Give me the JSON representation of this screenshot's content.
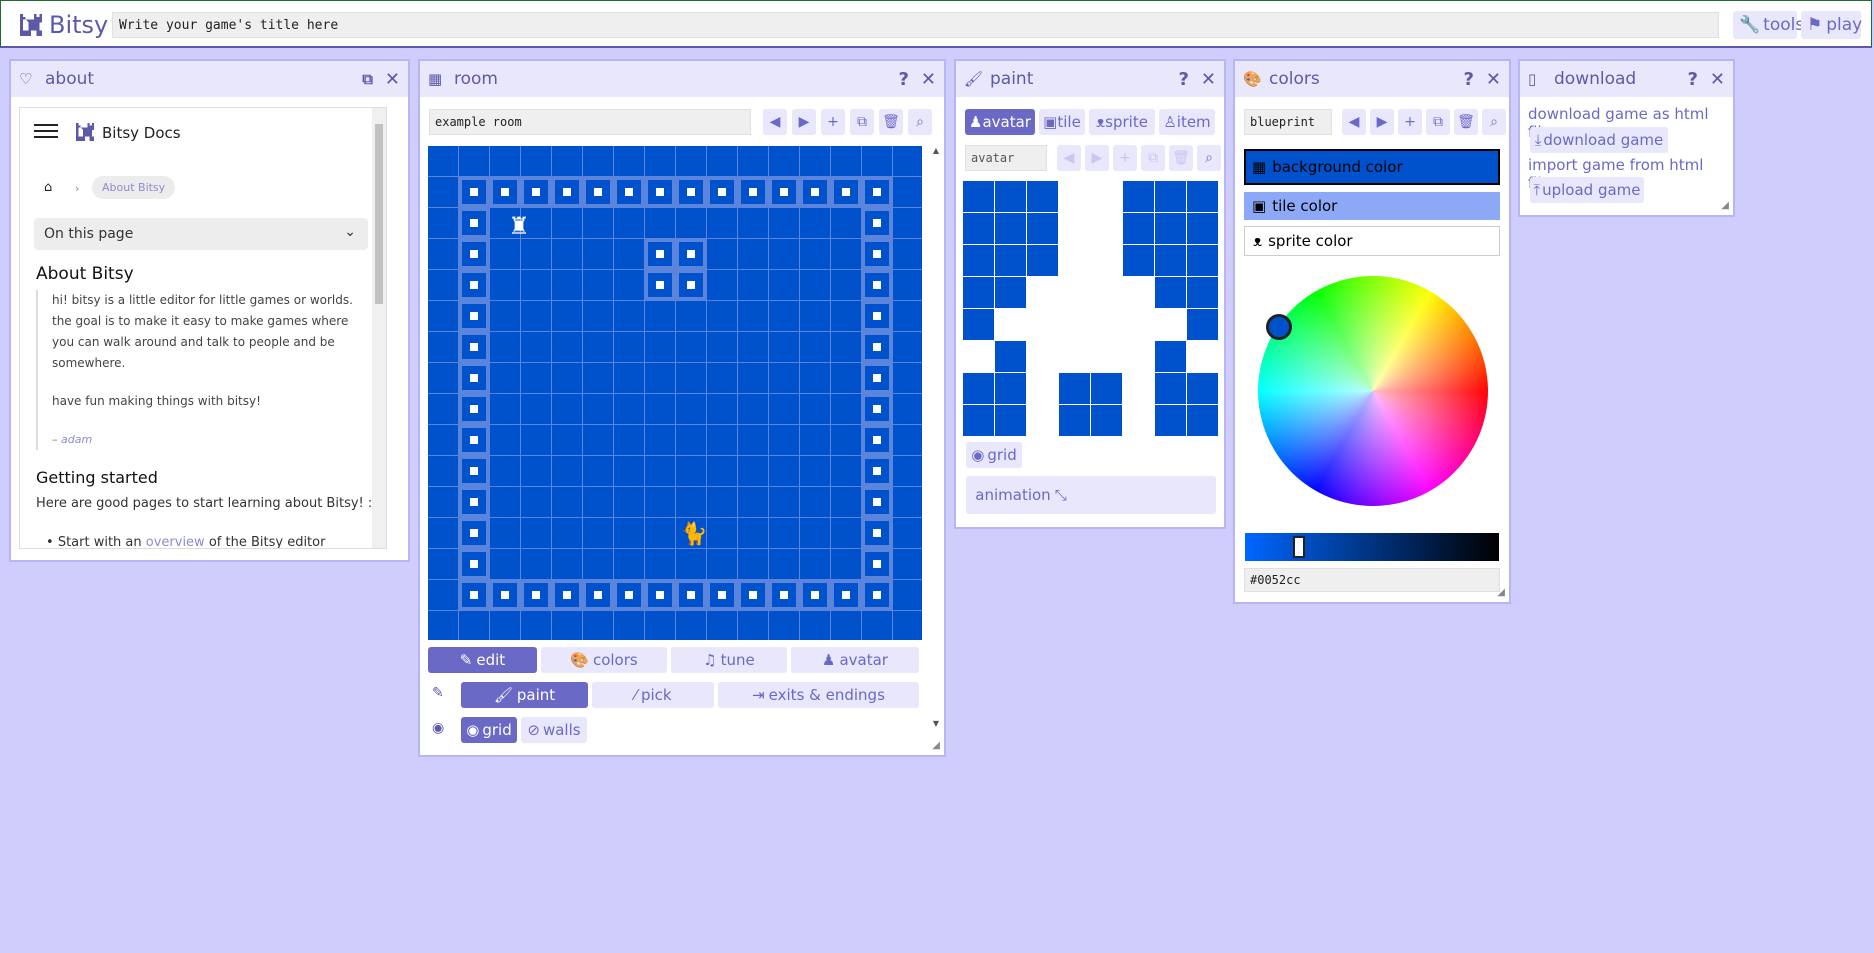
{
  "topbar": {
    "app_name": "Bitsy",
    "title_placeholder": "Write your game's title here",
    "tools_label": "tools",
    "play_label": "play"
  },
  "about": {
    "title": "about",
    "docs_title": "Bitsy Docs",
    "breadcrumb_current": "About Bitsy",
    "on_this_page": "On this page",
    "heading": "About Bitsy",
    "quote_line1": "hi! bitsy is a little editor for little games or worlds.",
    "quote_line2": "the goal is to make it easy to make games where",
    "quote_line3": "you can walk around and talk to people and be",
    "quote_line4": "somewhere.",
    "quote_line5": "have fun making things with bitsy!",
    "quote_dash": "– ",
    "quote_author": "adam",
    "getting_started": "Getting started",
    "intro_text": "Here are good pages to start learning about Bitsy! :)",
    "list_item_prefix": "Start with an ",
    "list_item_link": "overview",
    "list_item_suffix": " of the Bitsy editor"
  },
  "room": {
    "title": "room",
    "room_name": "example room",
    "tabs": {
      "edit": "edit",
      "colors": "colors",
      "tune": "tune",
      "avatar": "avatar"
    },
    "tools": {
      "paint": "paint",
      "pick": "pick",
      "exits": "exits & endings"
    },
    "view": {
      "grid": "grid",
      "walls": "walls"
    }
  },
  "paint": {
    "title": "paint",
    "tabs": {
      "avatar": "avatar",
      "tile": "tile",
      "sprite": "sprite",
      "item": "item"
    },
    "drawing_name": "avatar",
    "grid_label": "grid",
    "animation_label": "animation"
  },
  "colors": {
    "title": "colors",
    "palette_name": "blueprint",
    "background": "background color",
    "tile": "tile color",
    "sprite": "sprite color",
    "hex": "#0052cc",
    "value_slider": 0.2
  },
  "download": {
    "title": "download",
    "download_text": "download game as html file:",
    "download_button": "download game",
    "import_text": "import game from html file:",
    "upload_button": "upload game"
  },
  "palette": {
    "background": "#0052cc",
    "tile": "#8ea8f8",
    "sprite": "#ffffff",
    "accent": "#6b69c6"
  }
}
